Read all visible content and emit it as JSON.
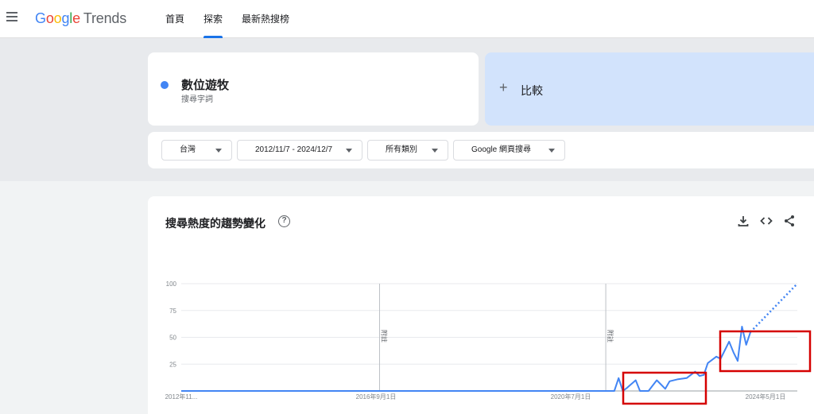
{
  "header": {
    "logo_google": [
      "G",
      "o",
      "o",
      "g",
      "l",
      "e"
    ],
    "logo_trends": "Trends",
    "nav": [
      {
        "label": "首頁",
        "active": false
      },
      {
        "label": "探索",
        "active": true
      },
      {
        "label": "最新熱搜榜",
        "active": false
      }
    ]
  },
  "term": {
    "name": "數位遊牧",
    "type": "搜尋字詞",
    "color": "#4285f4"
  },
  "compare": {
    "plus": "+",
    "label": "比較"
  },
  "filters": {
    "region": "台灣",
    "date_range": "2012/11/7 - 2024/12/7",
    "category": "所有類別",
    "search_type": "Google 網頁搜尋"
  },
  "chart_card": {
    "title": "搜尋熱度的趨勢變化",
    "help": "?"
  },
  "chart_data": {
    "type": "line",
    "title": "搜尋熱度的趨勢變化",
    "xlabel": "",
    "ylabel": "",
    "ylim": [
      0,
      100
    ],
    "y_ticks": [
      25,
      50,
      75,
      100
    ],
    "x_tick_labels": [
      "2012年11...",
      "2016年9月1日",
      "2020年7月1日",
      "2024年5月1日"
    ],
    "annotations": [
      "附註",
      "附註"
    ],
    "series": [
      {
        "color": "#4285f4",
        "points": [
          [
            "2012-11-04",
            0
          ],
          [
            "2016-09-01",
            0
          ],
          [
            "2020-07-01",
            0
          ],
          [
            "2021-05-01",
            0
          ],
          [
            "2021-06-01",
            12
          ],
          [
            "2021-07-01",
            0
          ],
          [
            "2021-08-01",
            3
          ],
          [
            "2021-10-01",
            10
          ],
          [
            "2021-11-01",
            0
          ],
          [
            "2022-01-01",
            0
          ],
          [
            "2022-03-01",
            10
          ],
          [
            "2022-05-01",
            2
          ],
          [
            "2022-06-01",
            9
          ],
          [
            "2022-08-01",
            11
          ],
          [
            "2022-10-01",
            12
          ],
          [
            "2022-12-01",
            18
          ],
          [
            "2023-01-01",
            14
          ],
          [
            "2023-02-01",
            15
          ],
          [
            "2023-03-01",
            26
          ],
          [
            "2023-05-01",
            32
          ],
          [
            "2023-06-01",
            30
          ],
          [
            "2023-08-01",
            46
          ],
          [
            "2023-09-01",
            36
          ],
          [
            "2023-10-01",
            28
          ],
          [
            "2023-11-01",
            60
          ],
          [
            "2023-12-01",
            43
          ],
          [
            "2024-01-01",
            55
          ]
        ],
        "projected": [
          [
            "2024-01-01",
            55
          ],
          [
            "2024-12-01",
            100
          ]
        ]
      }
    ]
  },
  "highlight_color": "#d50000"
}
